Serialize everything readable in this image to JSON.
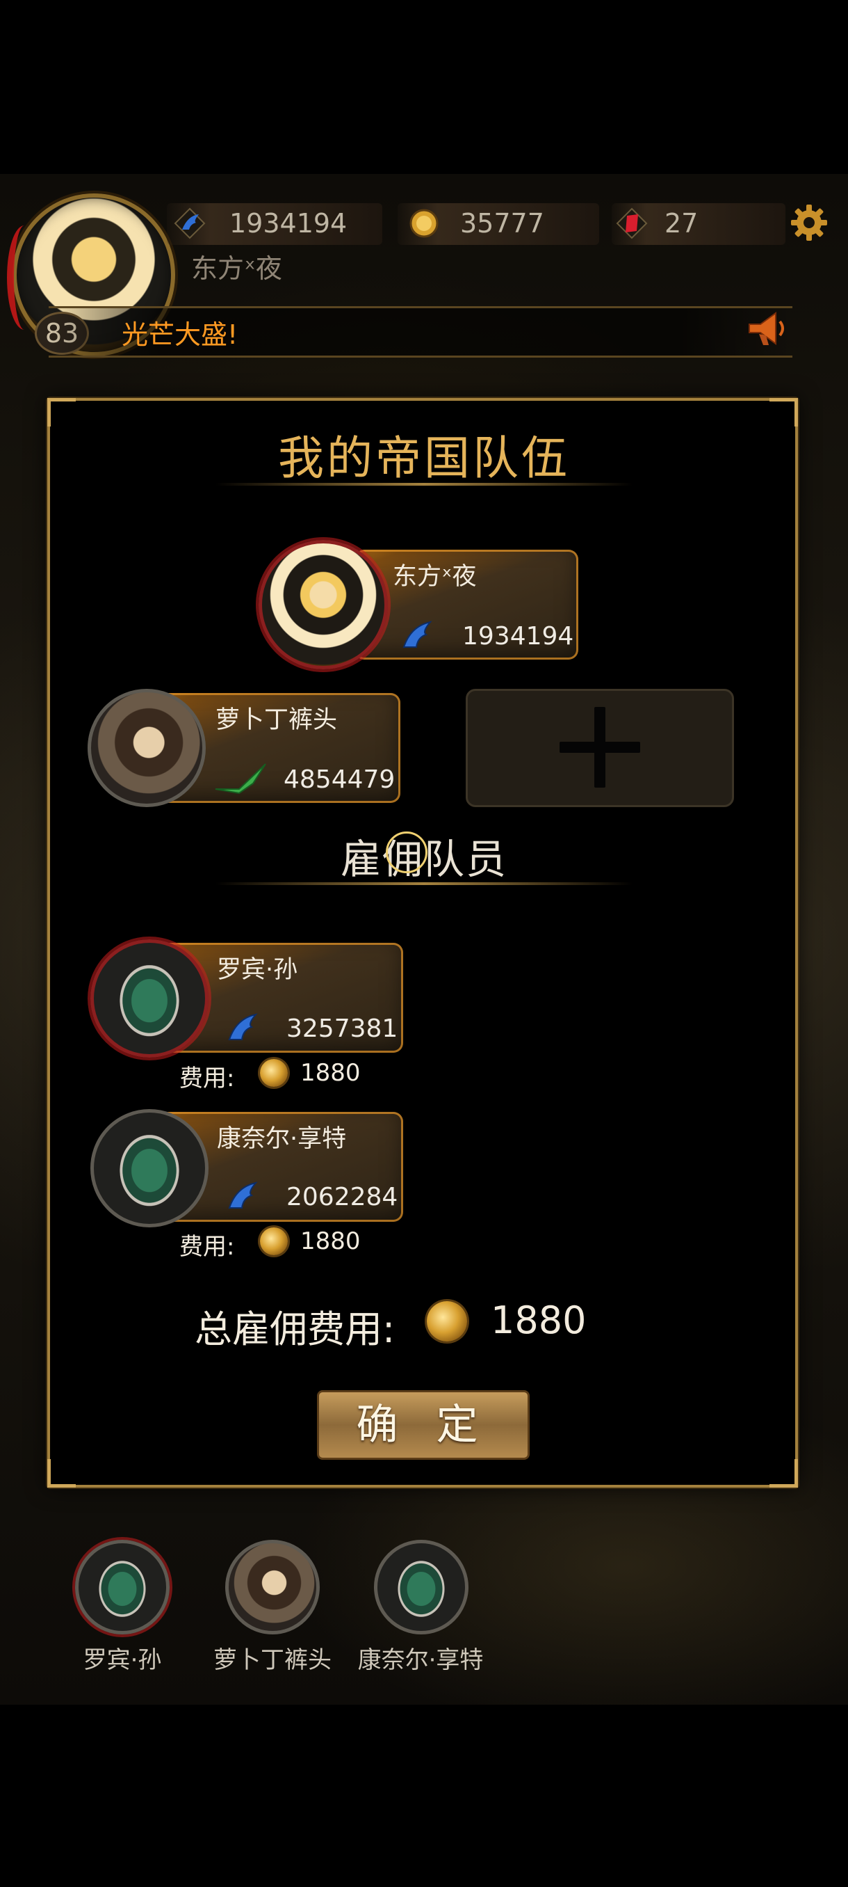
{
  "player": {
    "name": "东方ˣ夜",
    "level": "83",
    "power": "1934194",
    "gold": "35777",
    "gems": "27"
  },
  "notice": "光芒大盛!",
  "panel": {
    "title": "我的帝国队伍",
    "leader": {
      "name": "东方ˣ夜",
      "power": "1934194"
    },
    "member": {
      "name": "萝卜丁裤头",
      "power": "4854479"
    },
    "hire_title": "雇佣队员",
    "hires": [
      {
        "name": "罗宾·孙",
        "power": "3257381",
        "fee_label": "费用:",
        "fee": "1880"
      },
      {
        "name": "康奈尔·享特",
        "power": "2062284",
        "fee_label": "费用:",
        "fee": "1880"
      }
    ],
    "total_label": "总雇佣费用:",
    "total_value": "1880",
    "confirm_label": "确 定"
  },
  "bottom_list": [
    {
      "name": "罗宾·孙"
    },
    {
      "name": "萝卜丁裤头"
    },
    {
      "name": "康奈尔·享特"
    }
  ],
  "icons": {
    "power": "blue-wing-icon",
    "member_class": "green-bow-icon",
    "gold": "gold-coin-icon",
    "gem": "red-gem-icon",
    "settings": "gear-icon",
    "notice": "horn-icon"
  },
  "colors": {
    "accent_gold": "#e5b45a",
    "notice_orange": "#ff9a22"
  }
}
